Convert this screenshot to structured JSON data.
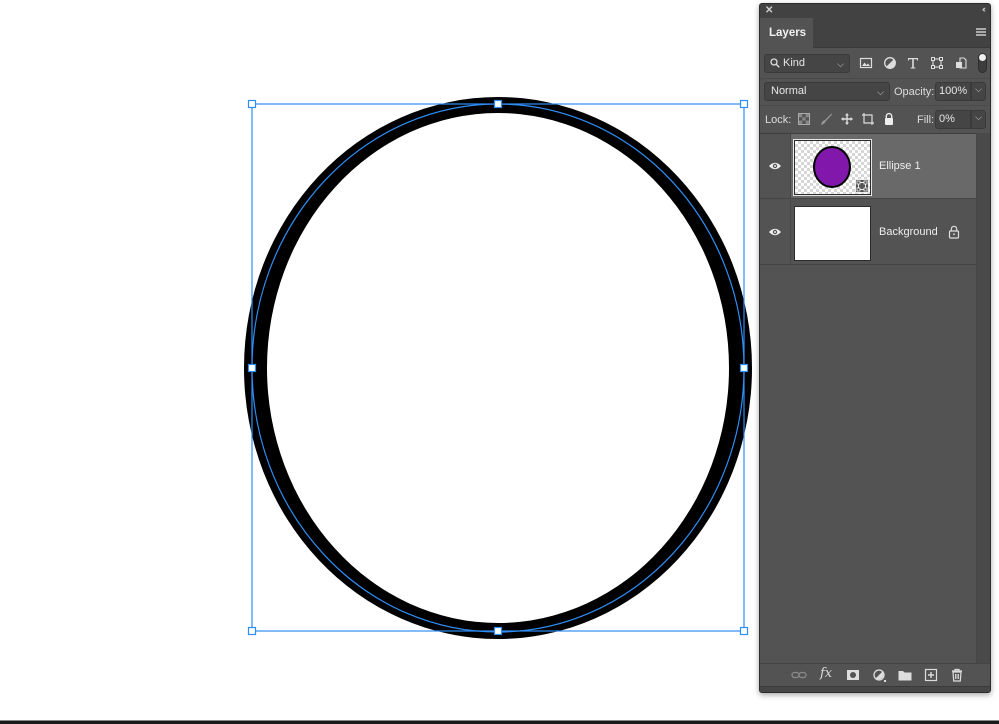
{
  "canvas": {
    "shape": "ellipse",
    "stroke_color": "#000000",
    "fill_color": "#ffffff",
    "selection_color": "#2f8ef5"
  },
  "layers_panel": {
    "close_icon": "close-icon",
    "collapse_icon": "double-chevron-left-icon",
    "tab_label": "Layers",
    "menu_icon": "hamburger-menu-icon",
    "filter": {
      "kind_label": "Kind",
      "icons": [
        "pixel-layer-filter-icon",
        "adjustment-layer-filter-icon",
        "type-layer-filter-icon",
        "shape-layer-filter-icon",
        "smart-object-filter-icon"
      ],
      "toggle_on": true
    },
    "blend_mode": "Normal",
    "opacity_label": "Opacity:",
    "opacity_value": "100%",
    "lock_label": "Lock:",
    "lock_icons": [
      "lock-transparent-pixels-icon",
      "lock-image-pixels-icon",
      "lock-position-icon",
      "lock-artboard-icon",
      "lock-all-icon"
    ],
    "fill_label": "Fill:",
    "fill_value": "0%",
    "layers": [
      {
        "name": "Ellipse 1",
        "visible": true,
        "selected": true,
        "type": "shape",
        "thumb_color": "#8118ab"
      },
      {
        "name": "Background",
        "visible": true,
        "selected": false,
        "locked": true,
        "type": "pixel"
      }
    ],
    "footer_icons": [
      "link-layers-icon",
      "layer-style-fx-icon",
      "add-mask-icon",
      "adjustment-layer-icon",
      "new-group-folder-icon",
      "new-layer-icon",
      "delete-layer-trash-icon"
    ],
    "fx_label": "fx"
  }
}
